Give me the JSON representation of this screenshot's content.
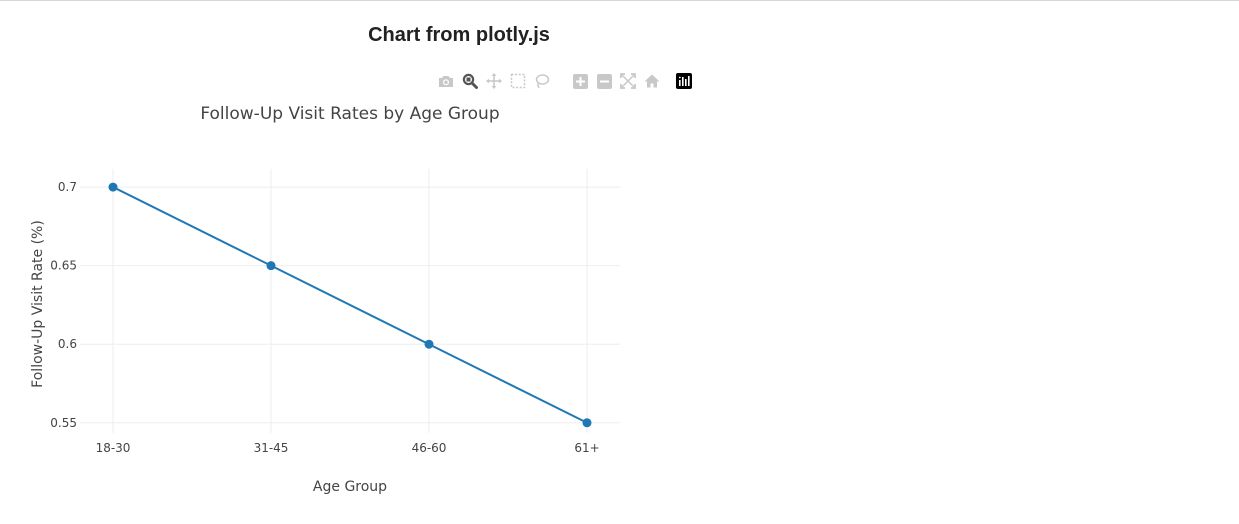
{
  "page": {
    "title": "Chart from plotly.js"
  },
  "modebar": {
    "icons": [
      "camera-icon",
      "zoom-icon",
      "pan-icon",
      "box-select-icon",
      "lasso-icon",
      "zoom-in-icon",
      "zoom-out-icon",
      "autoscale-icon",
      "reset-axes-icon",
      "plotly-logo-icon"
    ]
  },
  "chart_data": {
    "type": "line",
    "title": "Follow-Up Visit Rates by Age Group",
    "xlabel": "Age Group",
    "ylabel": "Follow-Up Visit Rate (%)",
    "categories": [
      "18-30",
      "31-45",
      "46-60",
      "61+"
    ],
    "values": [
      0.7,
      0.65,
      0.6,
      0.55
    ],
    "yticks": [
      0.55,
      0.6,
      0.65,
      0.7
    ],
    "ytick_labels": [
      "0.55",
      "0.6",
      "0.65",
      "0.7"
    ],
    "ylim": [
      0.5435,
      0.7115
    ],
    "grid": true,
    "legend": "none",
    "colors": {
      "line": "#1f77b4",
      "grid": "#eeeeee"
    }
  }
}
